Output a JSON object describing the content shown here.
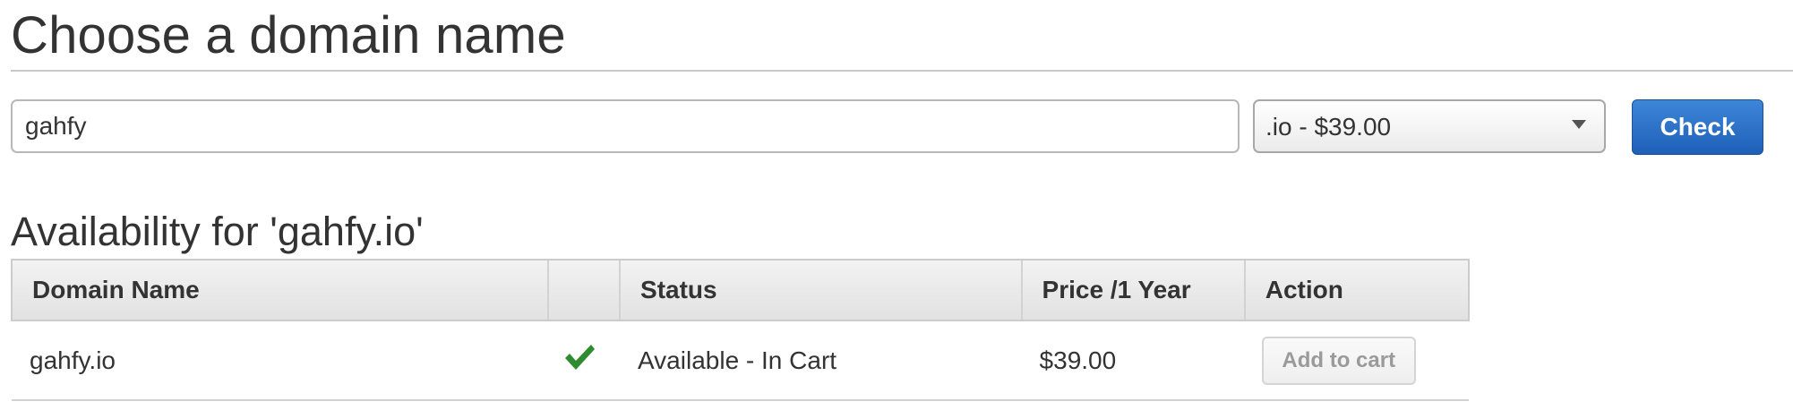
{
  "page": {
    "title": "Choose a domain name"
  },
  "search": {
    "domain_value": "gahfy",
    "tld_selected": ".io - $39.00",
    "check_label": "Check"
  },
  "availability": {
    "title": "Availability for 'gahfy.io'",
    "columns": [
      "Domain Name",
      "",
      "Status",
      "Price /1 Year",
      "Action"
    ],
    "rows": [
      {
        "domain": "gahfy.io",
        "available_icon": "check-icon",
        "status": "Available - In Cart",
        "price": "$39.00",
        "action_label": "Add to cart",
        "action_enabled": false
      }
    ]
  },
  "colors": {
    "primary_button": "#2b6fc6",
    "check_mark": "#2e8b2e",
    "disabled_text": "#9a9a9a"
  }
}
